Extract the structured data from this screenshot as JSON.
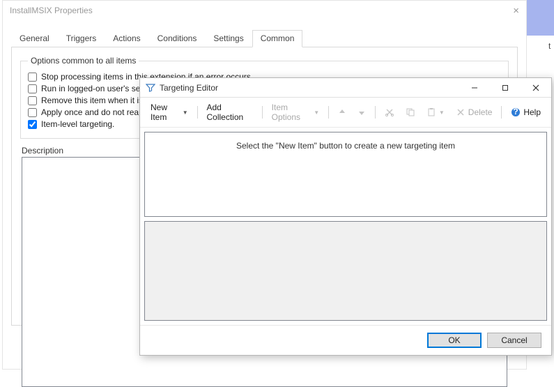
{
  "peek_char": "t",
  "props": {
    "title": "InstallMSIX Properties",
    "tabs": [
      "General",
      "Triggers",
      "Actions",
      "Conditions",
      "Settings",
      "Common"
    ],
    "active_tab": "Common",
    "group_legend": "Options common to all items",
    "checkboxes": [
      {
        "label": "Stop processing items in this extension if an error occurs.",
        "checked": false
      },
      {
        "label": "Run in logged-on user's securi",
        "checked": false
      },
      {
        "label": "Remove this item when it is no",
        "checked": false
      },
      {
        "label": "Apply once and do not reapply",
        "checked": false
      },
      {
        "label": "Item-level targeting.",
        "checked": true
      }
    ],
    "description_label": "Description"
  },
  "targeting": {
    "title": "Targeting Editor",
    "toolbar": {
      "new_item": "New Item",
      "add_collection": "Add Collection",
      "item_options": "Item Options",
      "delete": "Delete",
      "help": "Help"
    },
    "hint": "Select the \"New Item\" button to create a new targeting item",
    "ok": "OK",
    "cancel": "Cancel"
  }
}
